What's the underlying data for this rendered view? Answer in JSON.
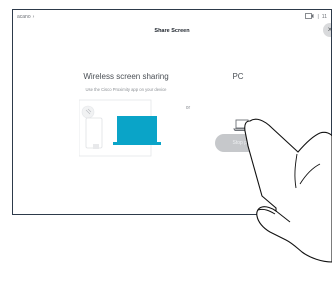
{
  "topbar": {
    "breadcrumb": "acano",
    "chevron": "›",
    "time": "11"
  },
  "dialog": {
    "title": "Share Screen",
    "close_symbol": "×"
  },
  "wireless": {
    "heading": "Wireless screen sharing",
    "subtext": "Use the Cisco Proximity app on your device"
  },
  "separator": "or",
  "pc": {
    "heading": "PC"
  },
  "stop_button": {
    "label": "Stop preview"
  },
  "colors": {
    "accent": "#0aa4c8",
    "frame": "#2d3a4a",
    "button": "#c6c8cb"
  },
  "icons": [
    "chevron-right-icon",
    "camera-icon",
    "close-icon",
    "wireless-devices-illustration",
    "laptop-icon",
    "hand-gesture-illustration"
  ]
}
